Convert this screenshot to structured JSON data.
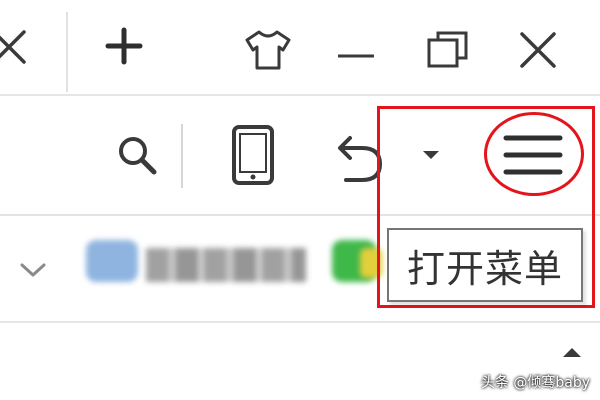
{
  "titlebar": {
    "icons": [
      "close-tab-icon",
      "new-tab-icon",
      "skin-icon",
      "minimize-icon",
      "restore-icon",
      "close-window-icon"
    ]
  },
  "toolbar": {
    "icons": [
      "search-icon",
      "mobile-device-icon",
      "undo-icon",
      "dropdown-arrow-icon",
      "hamburger-menu-icon"
    ]
  },
  "tooltip": {
    "text": "打开菜单"
  },
  "watermark": {
    "text": "头条 @倾骞baby"
  },
  "colors": {
    "highlight": "#e3141b",
    "icon": "#3a3a3a",
    "tooltip_border": "#767676"
  }
}
